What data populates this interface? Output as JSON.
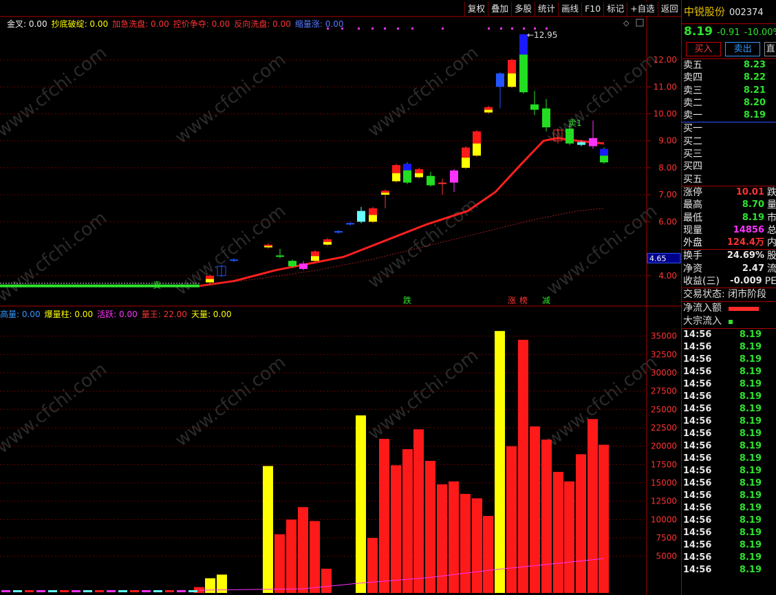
{
  "toolbar": [
    "复权",
    "叠加",
    "多股",
    "统计",
    "画线",
    "F10",
    "标记",
    "+自选",
    "返回"
  ],
  "indicators_top": [
    {
      "label": "金叉: 0.00",
      "color": "#f0f0f0"
    },
    {
      "label": "抄底破绽: 0.00",
      "color": "#ffff00"
    },
    {
      "label": "加急洗盘: 0.00",
      "color": "#ff3333"
    },
    {
      "label": "控价争夺: 0.00",
      "color": "#ff3333"
    },
    {
      "label": "反向洗盘: 0.00",
      "color": "#ff3333"
    },
    {
      "label": "缩量涨: 0.00",
      "color": "#5577ff"
    }
  ],
  "indicators_bottom": [
    {
      "label": "高量: 0.00",
      "color": "#3399ff"
    },
    {
      "label": "爆量柱: 0.00",
      "color": "#ffff00"
    },
    {
      "label": "活跃: 0.00",
      "color": "#ff33ff"
    },
    {
      "label": "量王: 22.00",
      "color": "#ff3333"
    },
    {
      "label": "天量: 0.00",
      "color": "#ffff00"
    }
  ],
  "price_labels": [
    "12.00",
    "11.00",
    "10.00",
    "9.00",
    "8.00",
    "7.00",
    "6.00",
    "4.00"
  ],
  "current_price_marker": "4.65",
  "high_annotation": "12.95",
  "signal_labels": {
    "die": "跌",
    "zhang": "涨",
    "bang": "榜",
    "jian": "减",
    "mai1": "卖1",
    "mai_low": "卖"
  },
  "volume_labels": [
    "35000",
    "32500",
    "30000",
    "27500",
    "25000",
    "22500",
    "20000",
    "17500",
    "15000",
    "12500",
    "10000",
    "7500",
    "5000"
  ],
  "watermark": "www.cfchi.com",
  "chart_data": {
    "type": "bar",
    "title": "",
    "candles_approx": [
      {
        "o": 4.9,
        "c": 5.2,
        "h": 5.25,
        "l": 4.85
      },
      {
        "o": 5.2,
        "c": 5.45,
        "h": 5.5,
        "l": 5.15
      },
      {
        "o": 5.9,
        "c": 5.95,
        "h": 6.0,
        "l": 5.85
      },
      {
        "o": 6.4,
        "c": 6.6,
        "h": 6.7,
        "l": 6.35
      },
      {
        "o": 4.9,
        "c": 4.75,
        "h": 4.95,
        "l": 4.7
      },
      {
        "o": 5.1,
        "c": 5.3,
        "h": 5.35,
        "l": 5.05
      },
      {
        "o": 6.5,
        "c": 6.35,
        "h": 6.6,
        "l": 6.3
      },
      {
        "o": 6.9,
        "c": 6.95,
        "h": 7.3,
        "l": 6.5
      },
      {
        "o": 7.85,
        "c": 8.25,
        "h": 8.35,
        "l": 7.8
      },
      {
        "o": 8.65,
        "c": 8.1,
        "h": 8.7,
        "l": 8.05
      },
      {
        "o": 8.4,
        "c": 8.3,
        "h": 8.45,
        "l": 8.2
      },
      {
        "o": 8.25,
        "c": 8.0,
        "h": 8.35,
        "l": 7.95
      },
      {
        "o": 8.4,
        "c": 8.8,
        "h": 8.85,
        "l": 8.2
      },
      {
        "o": 9.0,
        "c": 9.85,
        "h": 9.9,
        "l": 8.95
      },
      {
        "o": 10.1,
        "c": 10.35,
        "h": 10.4,
        "l": 10.05
      },
      {
        "o": 10.85,
        "c": 11.25,
        "h": 11.3,
        "l": 10.25
      },
      {
        "o": 11.5,
        "c": 11.95,
        "h": 12.0,
        "l": 11.4
      },
      {
        "o": 12.95,
        "c": 11.05,
        "h": 12.95,
        "l": 10.9
      },
      {
        "o": 10.3,
        "c": 10.15,
        "h": 10.85,
        "l": 9.95
      },
      {
        "o": 10.3,
        "c": 9.45,
        "h": 10.55,
        "l": 9.3
      }
    ],
    "volumes": [
      {
        "v": 800,
        "c": "red"
      },
      {
        "v": 2000,
        "c": "yellow"
      },
      {
        "v": 2500,
        "c": "yellow"
      },
      {
        "v": 17300,
        "c": "yellow"
      },
      {
        "v": 8000,
        "c": "red"
      },
      {
        "v": 10000,
        "c": "red"
      },
      {
        "v": 11700,
        "c": "red"
      },
      {
        "v": 9800,
        "c": "red"
      },
      {
        "v": 3300,
        "c": "red"
      },
      {
        "v": 24200,
        "c": "yellow"
      },
      {
        "v": 7500,
        "c": "red"
      },
      {
        "v": 21000,
        "c": "red"
      },
      {
        "v": 17400,
        "c": "red"
      },
      {
        "v": 19600,
        "c": "red"
      },
      {
        "v": 22300,
        "c": "red"
      },
      {
        "v": 18000,
        "c": "red"
      },
      {
        "v": 14800,
        "c": "red"
      },
      {
        "v": 15200,
        "c": "red"
      },
      {
        "v": 13500,
        "c": "red"
      },
      {
        "v": 12900,
        "c": "red"
      },
      {
        "v": 10500,
        "c": "red"
      },
      {
        "v": 35700,
        "c": "yellow"
      },
      {
        "v": 20000,
        "c": "red"
      },
      {
        "v": 34500,
        "c": "red"
      },
      {
        "v": 22700,
        "c": "red"
      },
      {
        "v": 20900,
        "c": "red"
      },
      {
        "v": 16500,
        "c": "red"
      },
      {
        "v": 15200,
        "c": "red"
      },
      {
        "v": 18900,
        "c": "red"
      },
      {
        "v": 23700,
        "c": "red"
      },
      {
        "v": 20200,
        "c": "red"
      }
    ],
    "ylim_price": [
      3.0,
      13.2
    ],
    "ylim_volume": [
      0,
      37500
    ]
  },
  "panel": {
    "name": "中锐股份",
    "code": "002374",
    "price": "8.19",
    "change": "-0.91",
    "pct": "-10.00%",
    "buy": "买入",
    "sell": "卖出",
    "more": "直",
    "asks": [
      [
        "卖五",
        "8.23"
      ],
      [
        "卖四",
        "8.22"
      ],
      [
        "卖三",
        "8.21"
      ],
      [
        "卖二",
        "8.20"
      ],
      [
        "卖一",
        "8.19"
      ]
    ],
    "bids": [
      "买一",
      "买二",
      "买三",
      "买四",
      "买五"
    ],
    "stats": [
      {
        "l": "涨停",
        "v": "10.01",
        "t": "跌",
        "vc": "#ff3333"
      },
      {
        "l": "最高",
        "v": "8.70",
        "t": "量",
        "vc": "#2ee32e"
      },
      {
        "l": "最低",
        "v": "8.19",
        "t": "市",
        "vc": "#2ee32e"
      },
      {
        "l": "现量",
        "v": "14856",
        "t": "总",
        "vc": "#ff33ff"
      },
      {
        "l": "外盘",
        "v": "124.4万",
        "t": "内",
        "vc": "#ff3333"
      }
    ],
    "stats2": [
      {
        "l": "换手",
        "v": "24.69%",
        "t": "股",
        "vc": "#e6e6e6"
      },
      {
        "l": "净资",
        "v": "2.47",
        "t": "流",
        "vc": "#e6e6e6"
      },
      {
        "l": "收益(三)",
        "v": "-0.009",
        "t": "PE",
        "vc": "#e6e6e6"
      }
    ],
    "trade_state": "交易状态: 闭市阶段",
    "flow_in": "净流入额",
    "block_in": "大宗流入",
    "ticks": [
      [
        "14:56",
        "8.19"
      ],
      [
        "14:56",
        "8.19"
      ],
      [
        "14:56",
        "8.19"
      ],
      [
        "14:56",
        "8.19"
      ],
      [
        "14:56",
        "8.19"
      ],
      [
        "14:56",
        "8.19"
      ],
      [
        "14:56",
        "8.19"
      ],
      [
        "14:56",
        "8.19"
      ],
      [
        "14:56",
        "8.19"
      ],
      [
        "14:56",
        "8.19"
      ],
      [
        "14:56",
        "8.19"
      ],
      [
        "14:56",
        "8.19"
      ],
      [
        "14:56",
        "8.19"
      ],
      [
        "14:56",
        "8.19"
      ],
      [
        "14:56",
        "8.19"
      ],
      [
        "14:56",
        "8.19"
      ],
      [
        "14:56",
        "8.19"
      ],
      [
        "14:56",
        "8.19"
      ],
      [
        "14:56",
        "8.19"
      ],
      [
        "14:56",
        "8.19"
      ]
    ]
  }
}
